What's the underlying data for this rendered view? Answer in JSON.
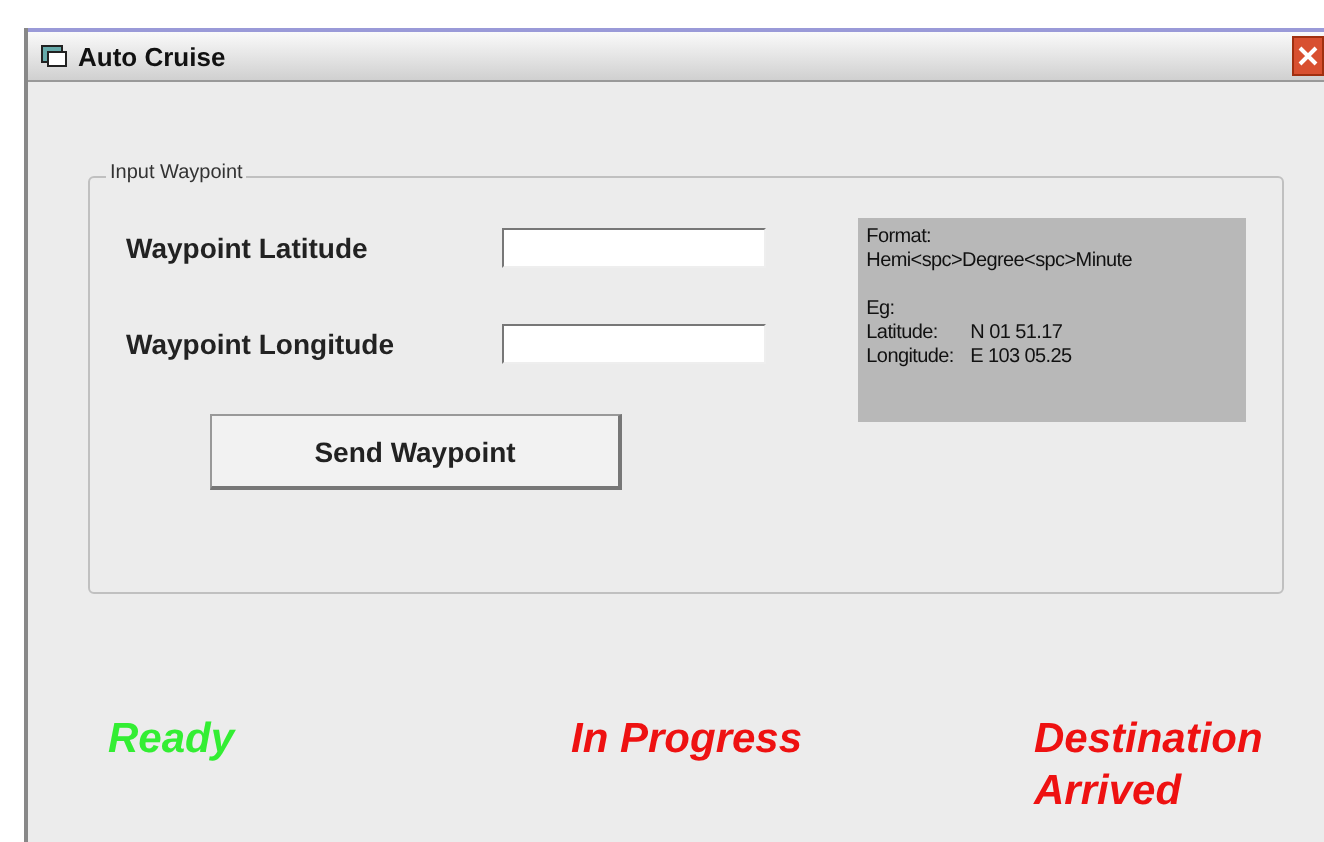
{
  "window": {
    "title": "Auto Cruise"
  },
  "group": {
    "title": "Input Waypoint",
    "fields": [
      {
        "label": "Waypoint Latitude"
      },
      {
        "label": "Waypoint Longitude"
      }
    ],
    "button": "Send Waypoint",
    "format_box": {
      "format_lines": [
        "Format:",
        "Hemi<spc>Degree<spc>Minute"
      ],
      "example_title": "Eg:",
      "examples": [
        {
          "label": "Latitude:",
          "value": "N 01 51.17"
        },
        {
          "label": "Longitude:",
          "value": "E 103 05.25"
        }
      ]
    }
  },
  "statuses": [
    {
      "label": "Ready",
      "color": "#33ee33"
    },
    {
      "label": "In Progress",
      "color": "#ee1111"
    },
    {
      "label": "Destination Arrived",
      "color": "#ee1111"
    }
  ]
}
